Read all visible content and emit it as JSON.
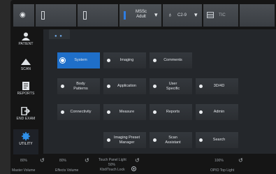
{
  "topbar": {
    "preset_name": "MSSc",
    "preset_type": "Adult",
    "probe": "C2-9",
    "tic": "TIC",
    "dropdown_symbol": "▾",
    "slot_icons": [
      "circle-icon",
      "probe-slot-icon",
      "probe-slot-icon",
      "probe-active-icon",
      "probe-icon",
      "image-mode-icon"
    ]
  },
  "nav": {
    "items": [
      {
        "label": "PATIENT",
        "icon": "person-icon"
      },
      {
        "label": "SCAN",
        "icon": "mountain-icon"
      },
      {
        "label": "REPORTS",
        "icon": "report-icon"
      },
      {
        "label": "END EXAM",
        "icon": "exit-icon"
      },
      {
        "label": "UTILITY",
        "icon": "gear-icon"
      }
    ],
    "active": "UTILITY"
  },
  "main": {
    "tab_indicator": "● ●",
    "buttons": [
      {
        "label": "System",
        "active": true
      },
      {
        "label": "Imaging",
        "active": false
      },
      {
        "label": "Comments",
        "active": false
      },
      {
        "label": "Body\nPatterns",
        "active": false
      },
      {
        "label": "Application",
        "active": false
      },
      {
        "label": "User\nSpecific",
        "active": false
      },
      {
        "label": "3D/4D",
        "active": false
      },
      {
        "label": "Connectivity",
        "active": false
      },
      {
        "label": "Measure",
        "active": false
      },
      {
        "label": "Reports",
        "active": false
      },
      {
        "label": "Admin",
        "active": false
      },
      {
        "label": "Imaging Preset\nManager",
        "active": false
      },
      {
        "label": "Scan\nAssistant",
        "active": false
      },
      {
        "label": "Search",
        "active": false
      }
    ]
  },
  "bottombar": {
    "master_volume_value": "80%",
    "master_volume_label": "Master Volume",
    "effects_volume_value": "80%",
    "effects_volume_label": "Effects Volume",
    "touch_panel_label": "Touch Panel Light",
    "touch_panel_value": "50%",
    "kbd_lock_label": "Kbd/Touch Lock",
    "opio_value": "100%",
    "opio_label": "OPIO Top Light",
    "knob_symbol": "↺",
    "colors": {
      "accent": "#1f6fc9",
      "panel": "#24272b"
    }
  }
}
